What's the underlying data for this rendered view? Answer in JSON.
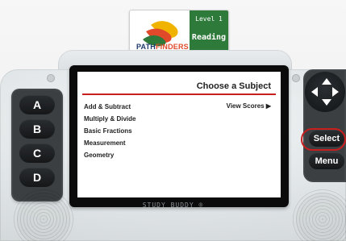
{
  "cartridge": {
    "brand_main": "PATH",
    "brand_accent": "FINDERS",
    "level": "Level 1",
    "subject": "Reading"
  },
  "screen": {
    "title": "Choose a Subject",
    "view_scores": "View Scores ▶",
    "subjects": [
      "Add & Subtract",
      "Multiply & Divide",
      "Basic Fractions",
      "Measurement",
      "Geometry"
    ]
  },
  "buttons": {
    "left": [
      "A",
      "B",
      "C",
      "D"
    ],
    "select": "Select",
    "menu": "Menu"
  },
  "device_label": "STUDY BUDDY ®",
  "colors": {
    "accent_red": "#c81e1e",
    "cartridge_green": "#2e7a3a",
    "pad_dark": "#3b3f42"
  },
  "icons": {
    "dpad": "arrow-keys-icon",
    "view_scores": "triangle-right-icon",
    "logo": "pathfinders-logo"
  }
}
